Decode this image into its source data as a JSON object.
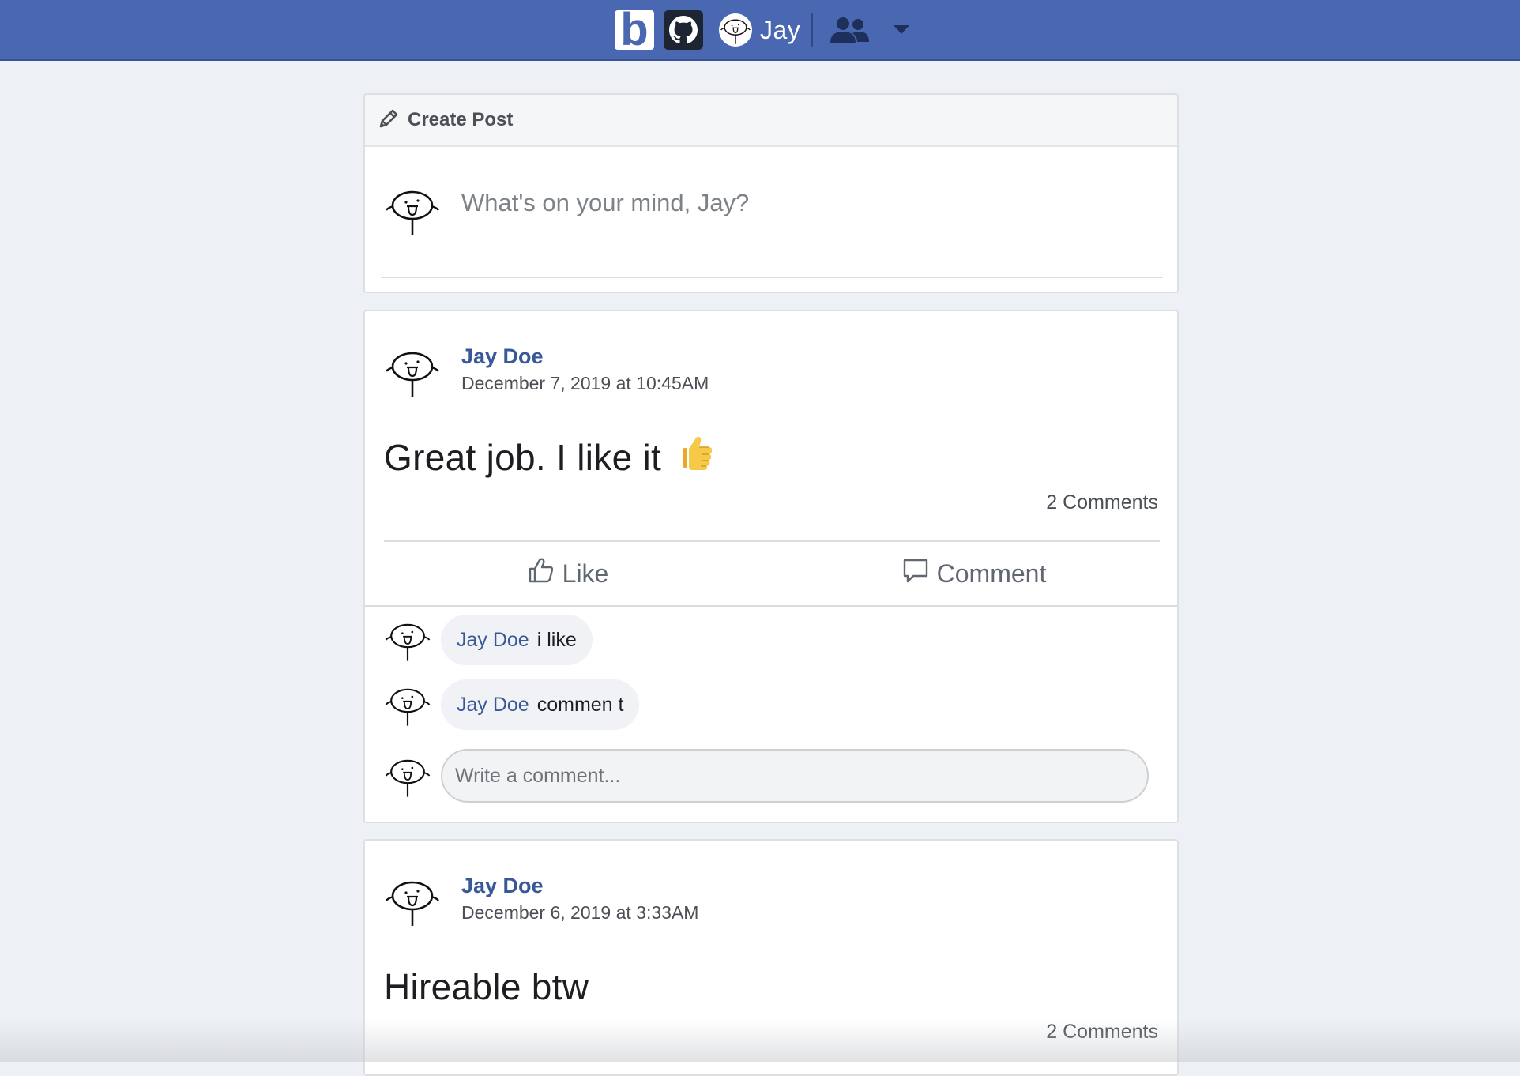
{
  "navbar": {
    "brand_letter": "b",
    "username": "Jay",
    "icons": {
      "brand": "brand-logo-icon",
      "github": "github-icon",
      "friends": "friends-icon",
      "menu": "caret-down-icon"
    }
  },
  "create_post": {
    "title": "Create Post",
    "placeholder": "What's on your mind, Jay?",
    "icon": "pencil-icon"
  },
  "posts": [
    {
      "author": "Jay Doe",
      "timestamp": "December 7, 2019 at 10:45AM",
      "text": "Great job. I like it",
      "emoji": "thumbs-up-emoji",
      "comments_count": "2 Comments",
      "actions": {
        "like": "Like",
        "comment": "Comment"
      },
      "comments": [
        {
          "author": "Jay Doe",
          "text": "i like"
        },
        {
          "author": "Jay Doe",
          "text": "commen t"
        }
      ],
      "comment_placeholder": "Write a comment..."
    },
    {
      "author": "Jay Doe",
      "timestamp": "December 6, 2019 at 3:33AM",
      "text": "Hireable btw",
      "comments_count": "2 Comments"
    }
  ],
  "colors": {
    "navbar": "#4a68b1",
    "link": "#385898",
    "page_bg": "#edf0f4"
  }
}
